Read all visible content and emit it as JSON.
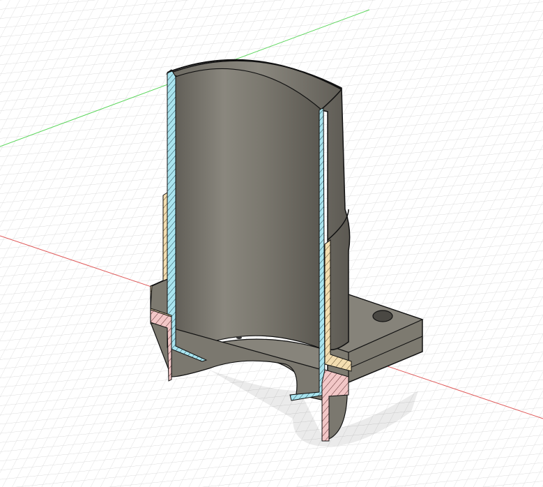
{
  "viewport": {
    "background": "#ffffff",
    "grid_color": "#d6d6d6",
    "x_axis_color": "#e05a5a",
    "y_axis_color": "#5cd65c"
  },
  "model": {
    "body_color": "#7d7a70",
    "inner_shade": "#6a675f",
    "edge_color": "#111111",
    "section_colors": {
      "inner_sleeve": "#a9e4ef",
      "outer_sleeve": "#f3ddb0",
      "base_flange": "#f2c7c7"
    }
  }
}
